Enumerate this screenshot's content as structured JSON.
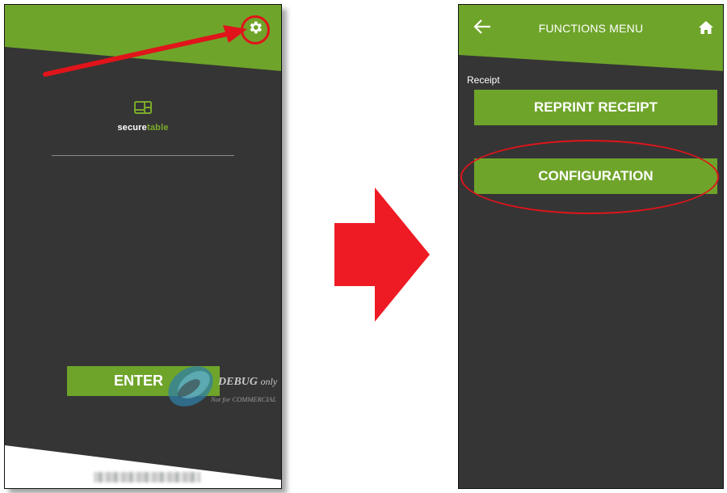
{
  "colors": {
    "brand_green": "#6fa42a",
    "background_dark": "#353535",
    "highlight_red": "#e0141a",
    "arrow_red": "#ee1b24"
  },
  "left_screen": {
    "settings_icon": "gear-icon",
    "logo": {
      "icon": "monitor-table-icon",
      "text_main": "secure",
      "text_accent": "table"
    },
    "enter_button": {
      "label": "ENTER"
    },
    "watermark": {
      "debug": "DEBUG",
      "only": "only",
      "not_for": "Not for COMMERCIAL"
    }
  },
  "arrow": {
    "icon": "big-right-arrow"
  },
  "right_screen": {
    "header": {
      "title": "FUNCTIONS MENU",
      "back_icon": "arrow-left-icon",
      "home_icon": "home-icon"
    },
    "section_label": "Receipt",
    "buttons": [
      {
        "label": "REPRINT RECEIPT"
      },
      {
        "label": "CONFIGURATION"
      }
    ]
  }
}
